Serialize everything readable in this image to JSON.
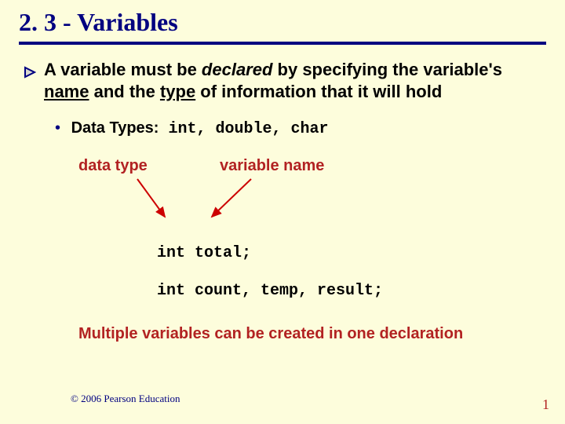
{
  "title": "2. 3 - Variables",
  "bullet1": {
    "pre": "A variable must be ",
    "declared": "declared",
    "mid": " by specifying the variable's ",
    "name": "name",
    "and": " and the ",
    "type": "type",
    "post": " of information that it will hold"
  },
  "bullet2": {
    "label": "Data Types:",
    "types": " int, double, char"
  },
  "labels": {
    "datatype": "data type",
    "varname": "variable name"
  },
  "code": {
    "line1": "int total;",
    "line2": "int count, temp, result;"
  },
  "note": "Multiple variables can be created in one declaration",
  "footer": {
    "copyright": "© 2006 Pearson Education",
    "page": "1"
  }
}
